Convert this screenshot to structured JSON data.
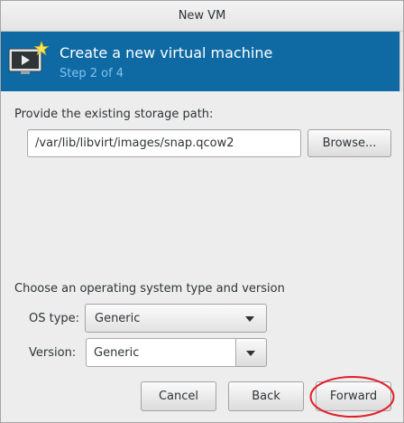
{
  "window": {
    "title": "New VM"
  },
  "banner": {
    "title": "Create a new virtual machine",
    "step": "Step 2 of 4",
    "icon": "new-vm-monitor-icon"
  },
  "storage": {
    "label": "Provide the existing storage path:",
    "path": "/var/lib/libvirt/images/snap.qcow2",
    "browse_label": "Browse..."
  },
  "os": {
    "section_label": "Choose an operating system type and version",
    "type_label": "OS type:",
    "type_value": "Generic",
    "version_label": "Version:",
    "version_value": "Generic"
  },
  "buttons": {
    "cancel": "Cancel",
    "back": "Back",
    "forward": "Forward"
  },
  "colors": {
    "banner_bg": "#0f6aa4",
    "step_text": "#7ec2f0",
    "highlight": "#e0202a"
  }
}
